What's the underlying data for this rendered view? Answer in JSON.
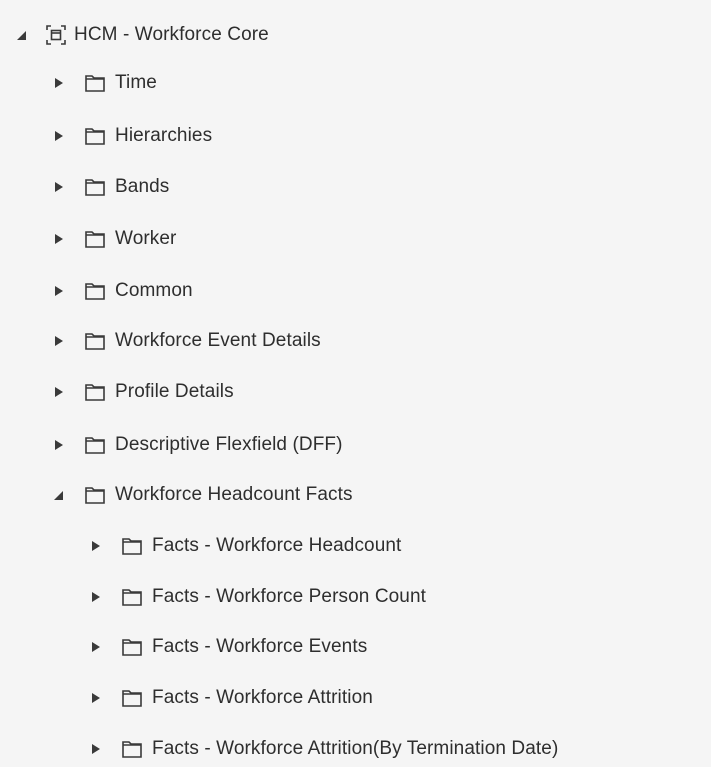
{
  "tree": {
    "root": {
      "label": "HCM - Workforce Core",
      "expanded": true,
      "icon": "subject-area-icon"
    },
    "children": [
      {
        "label": "Time",
        "expanded": false,
        "icon": "folder-icon"
      },
      {
        "label": "Hierarchies",
        "expanded": false,
        "icon": "folder-icon"
      },
      {
        "label": "Bands",
        "expanded": false,
        "icon": "folder-icon"
      },
      {
        "label": "Worker",
        "expanded": false,
        "icon": "folder-icon"
      },
      {
        "label": "Common",
        "expanded": false,
        "icon": "folder-icon"
      },
      {
        "label": "Workforce Event Details",
        "expanded": false,
        "icon": "folder-icon"
      },
      {
        "label": "Profile Details",
        "expanded": false,
        "icon": "folder-icon"
      },
      {
        "label": "Descriptive Flexfield (DFF)",
        "expanded": false,
        "icon": "folder-icon"
      },
      {
        "label": "Workforce Headcount Facts",
        "expanded": true,
        "icon": "folder-icon",
        "children": [
          {
            "label": "Facts - Workforce Headcount",
            "expanded": false,
            "icon": "folder-icon"
          },
          {
            "label": "Facts - Workforce Person Count",
            "expanded": false,
            "icon": "folder-icon"
          },
          {
            "label": "Facts - Workforce Events",
            "expanded": false,
            "icon": "folder-icon"
          },
          {
            "label": "Facts - Workforce Attrition",
            "expanded": false,
            "icon": "folder-icon"
          },
          {
            "label": "Facts - Workforce Attrition(By Termination Date)",
            "expanded": false,
            "icon": "folder-icon"
          }
        ]
      }
    ]
  },
  "colors": {
    "background": "#f5f5f5",
    "text": "#2e2e2e",
    "icon": "#3a3a3a"
  }
}
